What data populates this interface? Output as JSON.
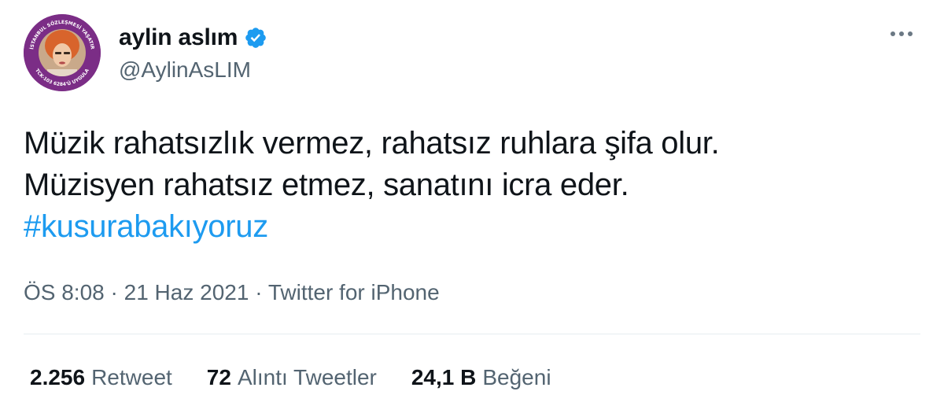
{
  "author": {
    "display_name": "aylin aslım",
    "handle": "@AylinAsLIM",
    "verified": true,
    "avatar_ring_text_top": "İSTANBUL SÖZLEŞMESİ YAŞATIR",
    "avatar_ring_text_bottom": "TCK-103   6284'Ü UYGULA"
  },
  "tweet": {
    "lines": [
      "Müzik rahatsızlık vermez, rahatsız ruhlara şifa olur.",
      "Müzisyen rahatsız etmez, sanatını icra eder."
    ],
    "hashtag": "#kusurabakıyoruz"
  },
  "meta": {
    "time": "ÖS 8:08",
    "separator": " · ",
    "date": "21 Haz 2021",
    "source": "Twitter for iPhone"
  },
  "stats": {
    "retweets": {
      "count": "2.256",
      "label": "Retweet"
    },
    "quotes": {
      "count": "72",
      "label": "Alıntı Tweetler"
    },
    "likes": {
      "count": "24,1 B",
      "label": "Beğeni"
    }
  },
  "colors": {
    "link": "#1d9bf0",
    "secondary_text": "#536471",
    "avatar_ring": "#7b2d86",
    "verified_badge": "#1d9bf0"
  },
  "icons": {
    "verified": "verified-badge-icon",
    "more": "more-options-icon"
  }
}
